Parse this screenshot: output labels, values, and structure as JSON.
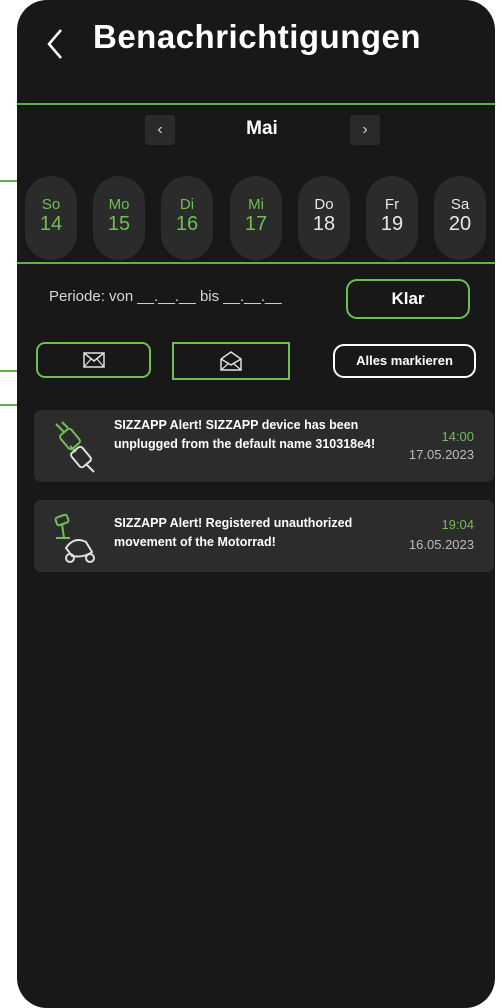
{
  "header": {
    "title": "Benachrichtigungen"
  },
  "calendar": {
    "month": "Mai",
    "days": [
      {
        "name": "So",
        "date": "14",
        "active": true
      },
      {
        "name": "Mo",
        "date": "15",
        "active": true
      },
      {
        "name": "Di",
        "date": "16",
        "active": true
      },
      {
        "name": "Mi",
        "date": "17",
        "active": true
      },
      {
        "name": "Do",
        "date": "18",
        "active": false
      },
      {
        "name": "Fr",
        "date": "19",
        "active": false
      },
      {
        "name": "Sa",
        "date": "20",
        "active": false
      }
    ]
  },
  "filter": {
    "period_text": "Periode: von __.__.__ bis __.__.__",
    "clear_label": "Klar"
  },
  "actions": {
    "mark_all_label": "Alles markieren"
  },
  "notifications": [
    {
      "icon": "unplug-icon",
      "message": "SIZZAPP Alert! SIZZAPP device has been unplugged from the default name 310318e4!",
      "time": "14:00",
      "date": "17.05.2023"
    },
    {
      "icon": "motorcycle-camera-icon",
      "message": "SIZZAPP Alert! Registered unauthorized movement of the Motorrad!",
      "time": "19:04",
      "date": "16.05.2023"
    }
  ],
  "colors": {
    "accent": "#6fbf55",
    "background": "#181818",
    "card": "#2c2c2c"
  }
}
